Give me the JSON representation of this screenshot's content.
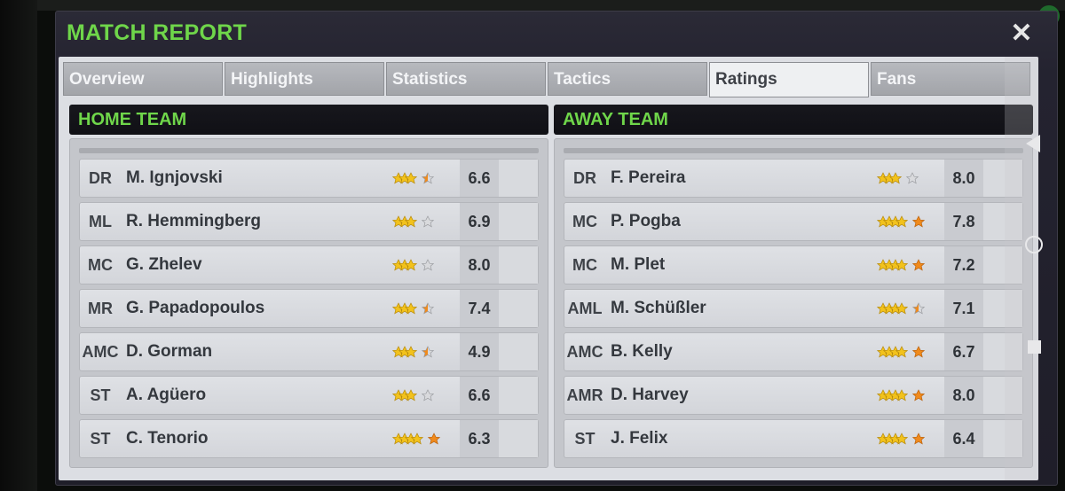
{
  "dialog": {
    "title": "MATCH REPORT",
    "close_icon": "close-icon"
  },
  "tabs": [
    {
      "label": "Overview",
      "active": false
    },
    {
      "label": "Highlights",
      "active": false
    },
    {
      "label": "Statistics",
      "active": false
    },
    {
      "label": "Tactics",
      "active": false
    },
    {
      "label": "Ratings",
      "active": true
    },
    {
      "label": "Fans",
      "active": false
    }
  ],
  "home": {
    "title": "HOME TEAM",
    "players": [
      {
        "pos": "DR",
        "name": "M. Ignjovski",
        "stars": 3.5,
        "rating": "6.6"
      },
      {
        "pos": "ML",
        "name": "R. Hemmingberg",
        "stars": 3.0,
        "rating": "6.9"
      },
      {
        "pos": "MC",
        "name": "G. Zhelev",
        "stars": 3.0,
        "rating": "8.0"
      },
      {
        "pos": "MR",
        "name": "G. Papadopoulos",
        "stars": 3.5,
        "rating": "7.4"
      },
      {
        "pos": "AMC",
        "name": "D. Gorman",
        "stars": 3.5,
        "rating": "4.9"
      },
      {
        "pos": "ST",
        "name": "A. Agüero",
        "stars": 3.0,
        "rating": "6.6"
      },
      {
        "pos": "ST",
        "name": "C. Tenorio",
        "stars": 4.0,
        "rating": "6.3"
      }
    ]
  },
  "away": {
    "title": "AWAY TEAM",
    "players": [
      {
        "pos": "DR",
        "name": "F. Pereira",
        "stars": 3.0,
        "rating": "8.0"
      },
      {
        "pos": "MC",
        "name": "P. Pogba",
        "stars": 4.0,
        "rating": "7.8"
      },
      {
        "pos": "MC",
        "name": "M. Plet",
        "stars": 4.0,
        "rating": "7.2"
      },
      {
        "pos": "AML",
        "name": "M. Schüßler",
        "stars": 4.5,
        "rating": "7.1"
      },
      {
        "pos": "AMC",
        "name": "B. Kelly",
        "stars": 4.0,
        "rating": "6.7"
      },
      {
        "pos": "AMR",
        "name": "D. Harvey",
        "stars": 4.0,
        "rating": "8.0"
      },
      {
        "pos": "ST",
        "name": "J. Felix",
        "stars": 4.0,
        "rating": "6.4"
      }
    ]
  },
  "colors": {
    "title_green": "#6fd64a",
    "star_gold": "#f2c21c",
    "star_orange": "#f08a1c",
    "star_empty": "#d9dadd"
  },
  "scroll": {
    "up_icon": "triangle-left-icon",
    "knob_icon": "circle-icon",
    "square_icon": "square-icon"
  }
}
